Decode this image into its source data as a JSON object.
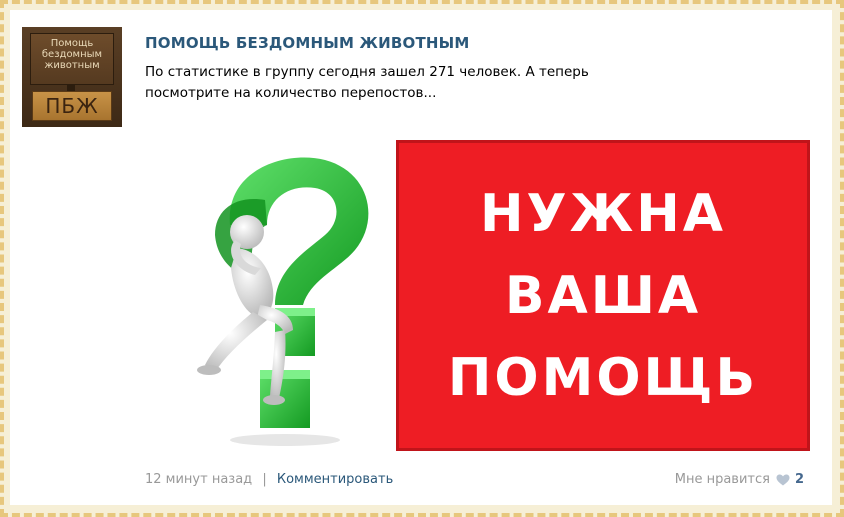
{
  "group": {
    "avatar_text_lines": [
      "Помощь",
      "бездомным",
      "животным"
    ],
    "avatar_badge": "ПБЖ",
    "name": "ПОМОЩЬ БЕЗДОМНЫМ ЖИВОТНЫМ"
  },
  "post": {
    "text_line1": "По статистике в группу сегодня зашел 271 человек. А теперь",
    "text_line2": "посмотрите на количество перепостов...",
    "banner_lines": [
      "НУЖНА",
      "ВАША",
      "ПОМОЩЬ"
    ]
  },
  "footer": {
    "time": "12 минут назад",
    "separator": "|",
    "comment_label": "Комментировать",
    "like_label": "Мне нравится",
    "like_count": "2"
  },
  "colors": {
    "banner_red": "#ee1d24",
    "link_blue": "#2b587a",
    "question_green": "#2fbf3a"
  },
  "icons": {
    "like": "heart-icon"
  }
}
